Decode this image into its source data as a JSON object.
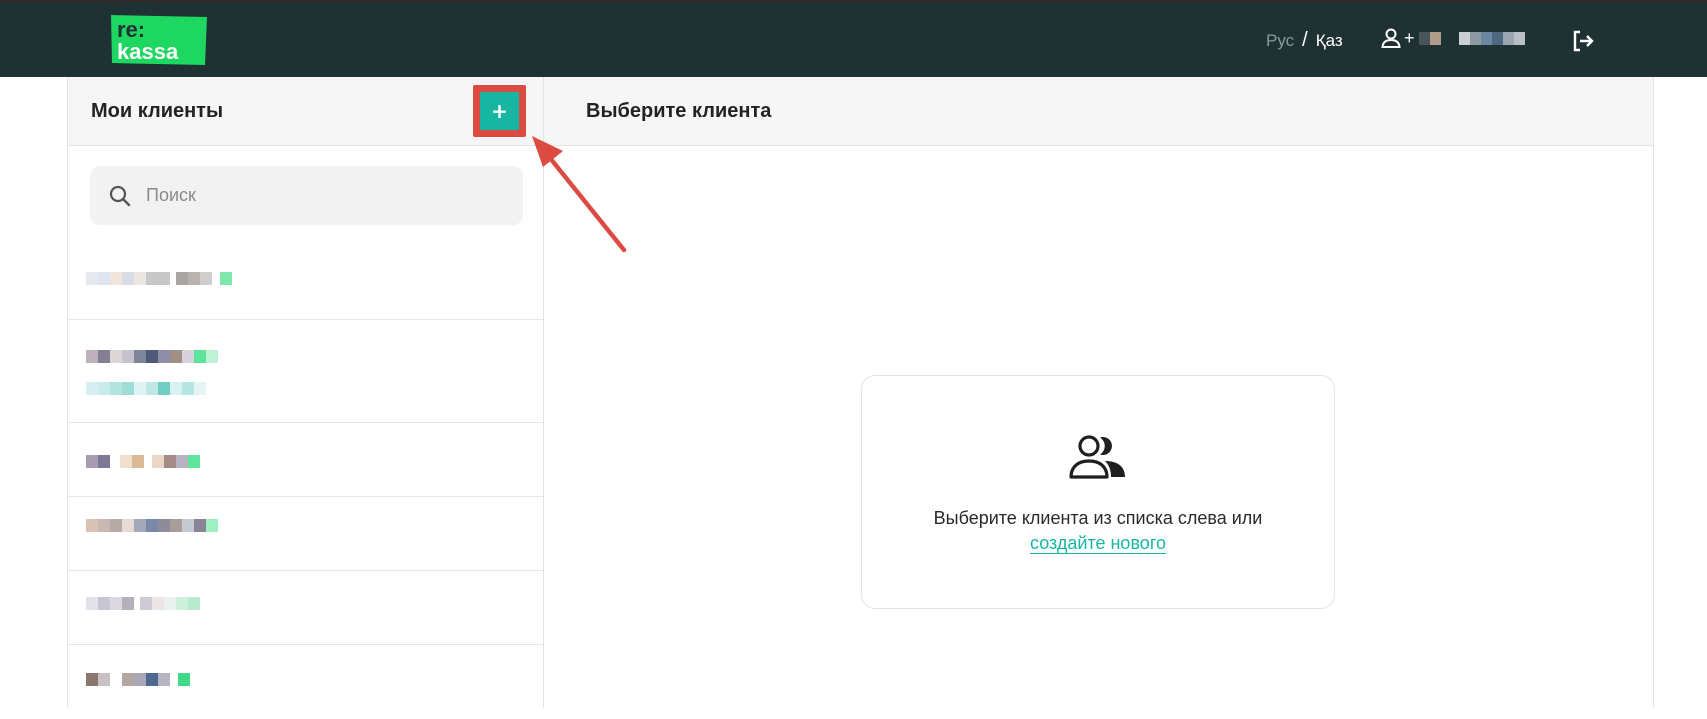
{
  "header": {
    "logo_text_top": "re:",
    "logo_text_bottom": "kassa",
    "lang_ru": "Рус",
    "lang_separator": "/",
    "lang_kz": "Қаз",
    "user_prefix": "+",
    "icons": {
      "user": "user-icon",
      "logout": "logout-icon"
    }
  },
  "clients_panel": {
    "title": "Мои клиенты",
    "add_label": "+",
    "search_placeholder": "Поиск"
  },
  "detail_panel": {
    "title": "Выберите клиента",
    "empty_text": "Выберите клиента из списка слева или",
    "create_link": "создайте нового"
  },
  "colors": {
    "topbar": "#1f3233",
    "accent": "#17b6a3",
    "brand_green": "#1ed760",
    "annotation": "#db4b41"
  }
}
